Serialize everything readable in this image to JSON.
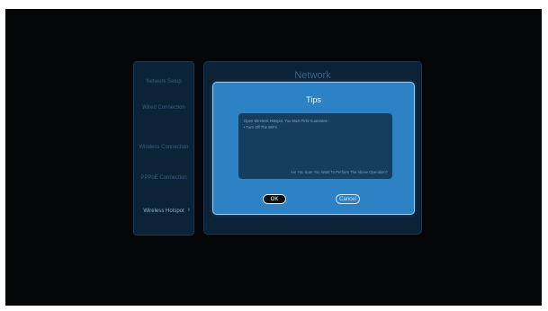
{
  "sidebar": {
    "title": "Network Setup",
    "items": [
      {
        "label": "Wired Connection"
      },
      {
        "label": "Wireless Connection"
      },
      {
        "label": "PPPoE Connection"
      },
      {
        "label": "Wireless Hotspot",
        "arrow": "›"
      }
    ]
  },
  "main": {
    "title": "Network"
  },
  "dialog": {
    "title": "Tips",
    "message_line1": "Open Wireless Hotspot, You Must First Guarantee :",
    "message_line2": "• Turn Off The WiFi!",
    "confirm_text": "Are You Sure You Want To Perform The Above Operation?",
    "ok_label": "OK",
    "cancel_label": "Cancel"
  },
  "colors": {
    "screen_bg": "#030506",
    "panel_bg": "#0b2237",
    "dialog_bg": "#2d82c6",
    "dialog_inner_bg": "#163c5e"
  }
}
